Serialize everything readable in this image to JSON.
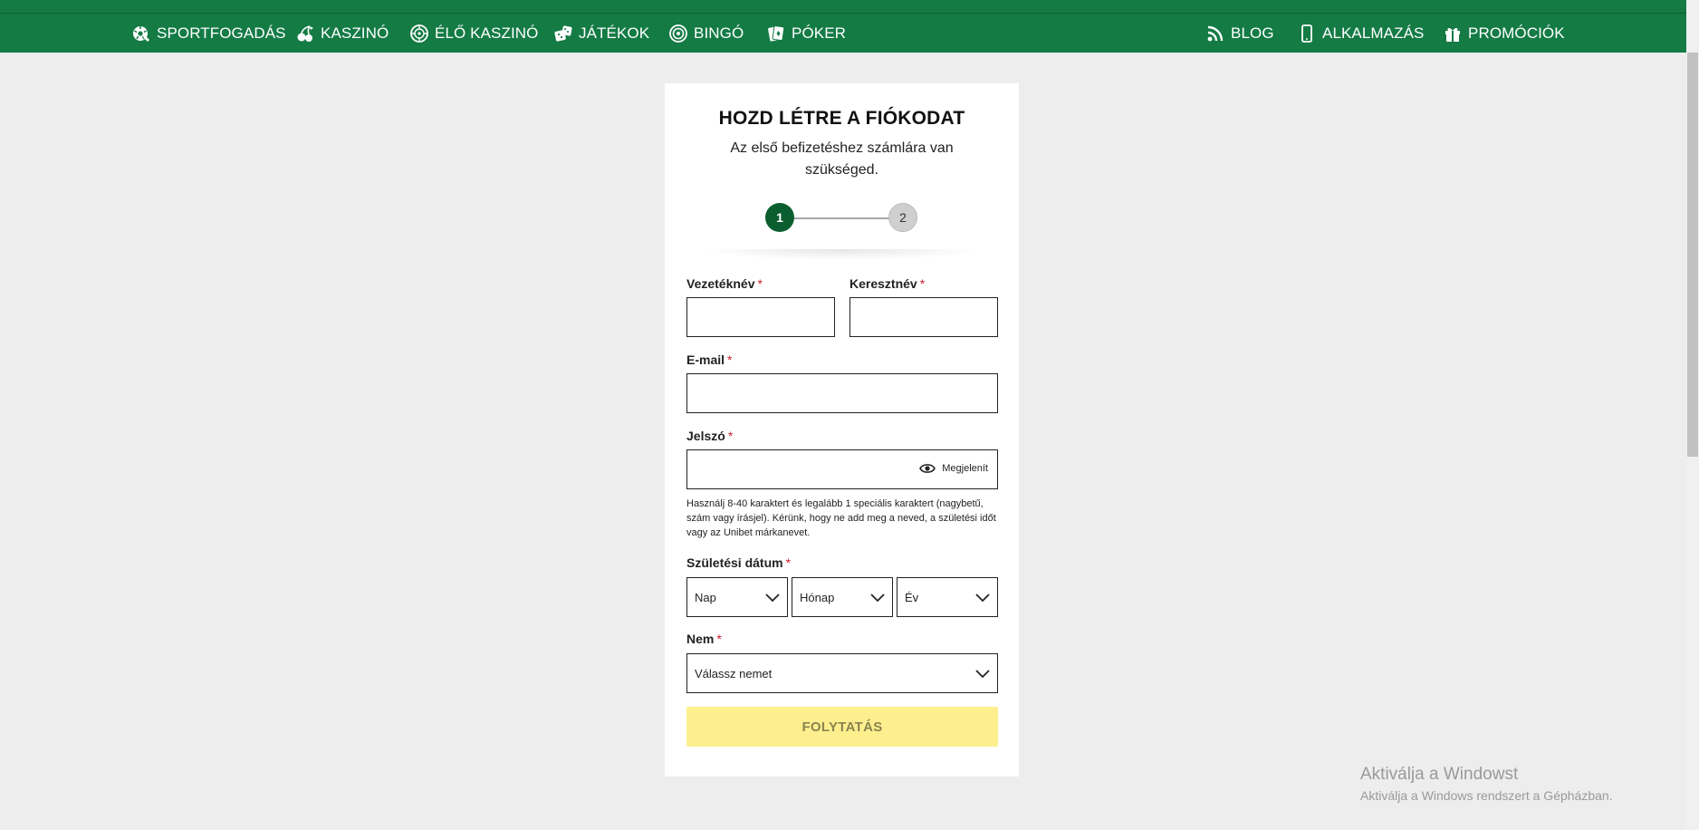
{
  "nav": {
    "left": [
      {
        "label": "SPORTFOGADÁS",
        "icon": "soccer-ball-icon"
      },
      {
        "label": "KASZINÓ",
        "icon": "cherries-icon"
      },
      {
        "label": "ÉLŐ KASZINÓ",
        "icon": "roulette-icon"
      },
      {
        "label": "JÁTÉKOK",
        "icon": "dice-icon"
      },
      {
        "label": "BINGÓ",
        "icon": "bingo-ball-icon"
      },
      {
        "label": "PÓKER",
        "icon": "playing-cards-icon"
      }
    ],
    "right": [
      {
        "label": "BLOG",
        "icon": "rss-icon"
      },
      {
        "label": "ALKALMAZÁS",
        "icon": "smartphone-icon"
      },
      {
        "label": "PROMÓCIÓK",
        "icon": "gift-icon"
      }
    ]
  },
  "form": {
    "title": "HOZD LÉTRE A FIÓKODAT",
    "subtitle": "Az első befizetéshez számlára van szükséged.",
    "steps": [
      "1",
      "2"
    ],
    "active_step": 1,
    "required_marker": "*",
    "last_name_label": "Vezetéknév",
    "first_name_label": "Keresztnév",
    "email_label": "E-mail",
    "password_label": "Jelszó",
    "show_password_label": "Megjelenít",
    "password_hint": "Használj 8-40 karaktert és legalább 1 speciális karaktert (nagybetű, szám vagy írásjel). Kérünk, hogy ne add meg a neved, a születési időt vagy az Unibet márkanevet.",
    "birthdate_label": "Születési dátum",
    "day_value": "Nap",
    "month_value": "Hónap",
    "year_value": "Év",
    "gender_label": "Nem",
    "gender_value": "Válassz nemet",
    "submit_label": "FOLYTATÁS"
  },
  "colors": {
    "brand_green": "#147b45",
    "step_active": "#0b5e2f",
    "submit_bg": "#fdef8e",
    "required": "#d0202e"
  },
  "watermark": {
    "line1": "Aktiválja a Windowst",
    "line2": "Aktiválja a Windows rendszert a Gépházban."
  }
}
